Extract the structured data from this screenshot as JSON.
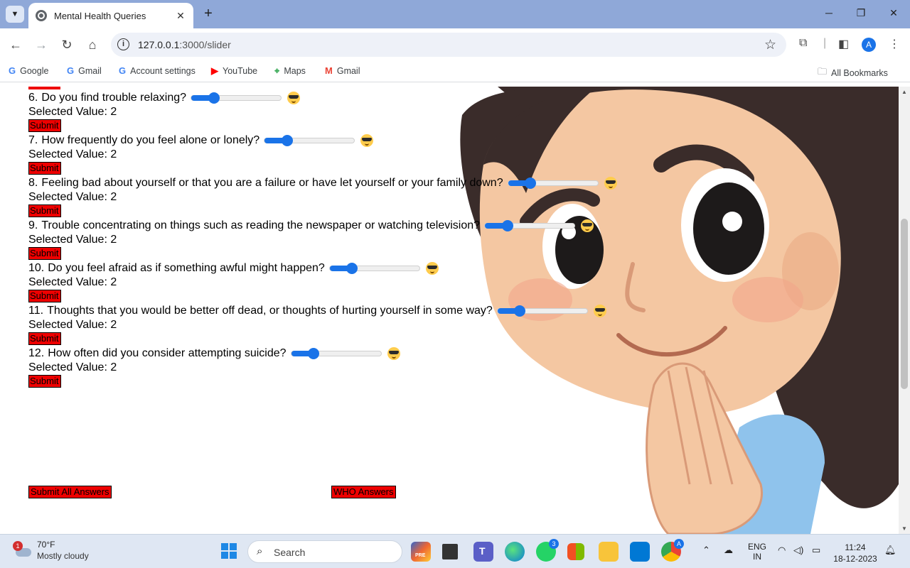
{
  "browser": {
    "tab_title": "Mental Health Queries",
    "new_tab_symbol": "+",
    "url_host": "127.0.0.1",
    "url_rest": ":3000/slider",
    "profile_initial": "A"
  },
  "bookmarks": [
    {
      "label": "Google",
      "icon": "google-icon",
      "color": "#4285f4"
    },
    {
      "label": "Gmail",
      "icon": "google-icon",
      "color": "#4285f4"
    },
    {
      "label": "Account settings",
      "icon": "google-icon",
      "color": "#4285f4"
    },
    {
      "label": "YouTube",
      "icon": "youtube-icon",
      "color": "#ff0000"
    },
    {
      "label": "Maps",
      "icon": "maps-icon",
      "color": "#34a853"
    },
    {
      "label": "Gmail",
      "icon": "gmail-icon",
      "color": "#ea4335"
    }
  ],
  "all_bookmarks_label": "All Bookmarks",
  "questions": [
    {
      "number": "6.",
      "text": "Do you find trouble relaxing?",
      "value": 2,
      "max": 5,
      "selected_label": "Selected Value: 2",
      "submit_label": "Submit"
    },
    {
      "number": "7.",
      "text": "How frequently do you feel alone or lonely?",
      "value": 2,
      "max": 5,
      "selected_label": "Selected Value: 2",
      "submit_label": "Submit"
    },
    {
      "number": "8.",
      "text": "Feeling bad about yourself or that you are a failure or have let yourself or your family down?",
      "value": 2,
      "max": 5,
      "selected_label": "Selected Value: 2",
      "submit_label": "Submit"
    },
    {
      "number": "9.",
      "text": "Trouble concentrating on things such as reading the newspaper or watching television?",
      "value": 2,
      "max": 5,
      "selected_label": "Selected Value: 2",
      "submit_label": "Submit"
    },
    {
      "number": "10.",
      "text": "Do you feel afraid as if something awful might happen?",
      "value": 2,
      "max": 5,
      "selected_label": "Selected Value: 2",
      "submit_label": "Submit"
    },
    {
      "number": "11.",
      "text": "Thoughts that you would be better off dead, or thoughts of hurting yourself in some way?",
      "value": 2,
      "max": 5,
      "selected_label": "Selected Value: 2",
      "submit_label": "Submit"
    },
    {
      "number": "12.",
      "text": "How often did you consider attempting suicide?",
      "value": 2,
      "max": 5,
      "selected_label": "Selected Value: 2",
      "submit_label": "Submit"
    }
  ],
  "actions": {
    "submit_all": "Submit All Answers",
    "who_answers": "WHO Answers"
  },
  "colors": {
    "button_red": "#ee0000",
    "slider_blue": "#1a73e8",
    "tabstrip": "#8fa8d8"
  },
  "taskbar": {
    "weather_temp": "70°F",
    "weather_condition": "Mostly cloudy",
    "weather_badge": "1",
    "search_placeholder": "Search",
    "whatsapp_badge": "3",
    "chrome_badge": "A",
    "copilot_tag": "PRE",
    "teams_letter": "T",
    "lang_top": "ENG",
    "lang_bottom": "IN",
    "time": "11:24",
    "date": "18-12-2023"
  }
}
